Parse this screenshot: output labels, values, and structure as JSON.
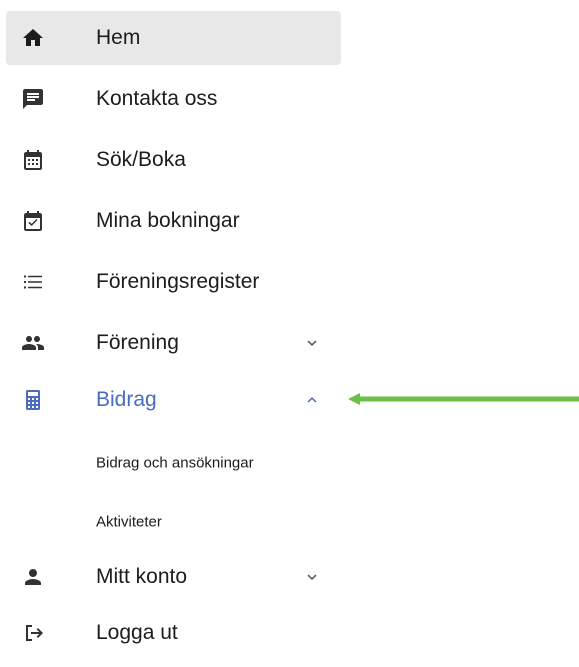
{
  "menu": {
    "items": [
      {
        "label": "Hem",
        "icon": "home-icon",
        "active": true
      },
      {
        "label": "Kontakta oss",
        "icon": "chat-icon"
      },
      {
        "label": "Sök/Boka",
        "icon": "calendar-icon"
      },
      {
        "label": "Mina bokningar",
        "icon": "calendar-check-icon"
      },
      {
        "label": "Föreningsregister",
        "icon": "list-icon"
      },
      {
        "label": "Förening",
        "icon": "group-icon",
        "chevron": "down"
      },
      {
        "label": "Bidrag",
        "icon": "calculator-icon",
        "chevron": "up",
        "expanded": true
      },
      {
        "label": "Mitt konto",
        "icon": "person-icon",
        "chevron": "down"
      },
      {
        "label": "Logga ut",
        "icon": "logout-icon"
      }
    ],
    "subitems": [
      {
        "label": "Bidrag och ansökningar"
      },
      {
        "label": "Aktiviteter"
      }
    ]
  },
  "colors": {
    "accent": "#4a6bbf",
    "active_bg": "#e8e8e8",
    "icon": "#333333",
    "arrow": "#6cc04a"
  }
}
